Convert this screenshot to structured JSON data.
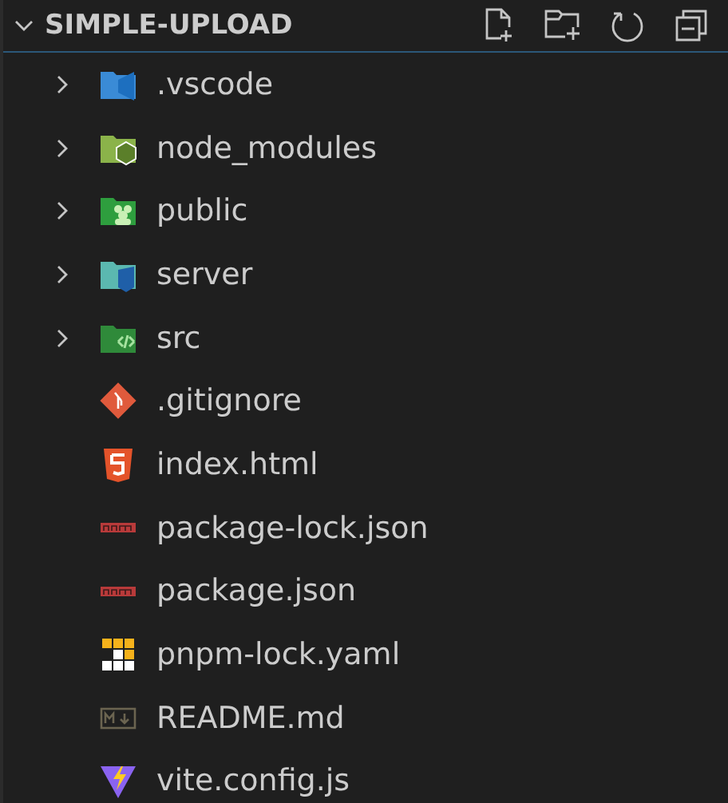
{
  "explorer": {
    "title": "SIMPLE-UPLOAD",
    "expanded": true
  },
  "items": [
    {
      "kind": "folder",
      "name": ".vscode",
      "expanded": false
    },
    {
      "kind": "folder",
      "name": "node_modules",
      "expanded": false
    },
    {
      "kind": "folder",
      "name": "public",
      "expanded": false
    },
    {
      "kind": "folder",
      "name": "server",
      "expanded": false
    },
    {
      "kind": "folder",
      "name": "src",
      "expanded": false
    },
    {
      "kind": "file",
      "name": ".gitignore"
    },
    {
      "kind": "file",
      "name": "index.html"
    },
    {
      "kind": "file",
      "name": "package-lock.json"
    },
    {
      "kind": "file",
      "name": "package.json"
    },
    {
      "kind": "file",
      "name": "pnpm-lock.yaml"
    },
    {
      "kind": "file",
      "name": "README.md"
    },
    {
      "kind": "file",
      "name": "vite.config.js"
    }
  ]
}
